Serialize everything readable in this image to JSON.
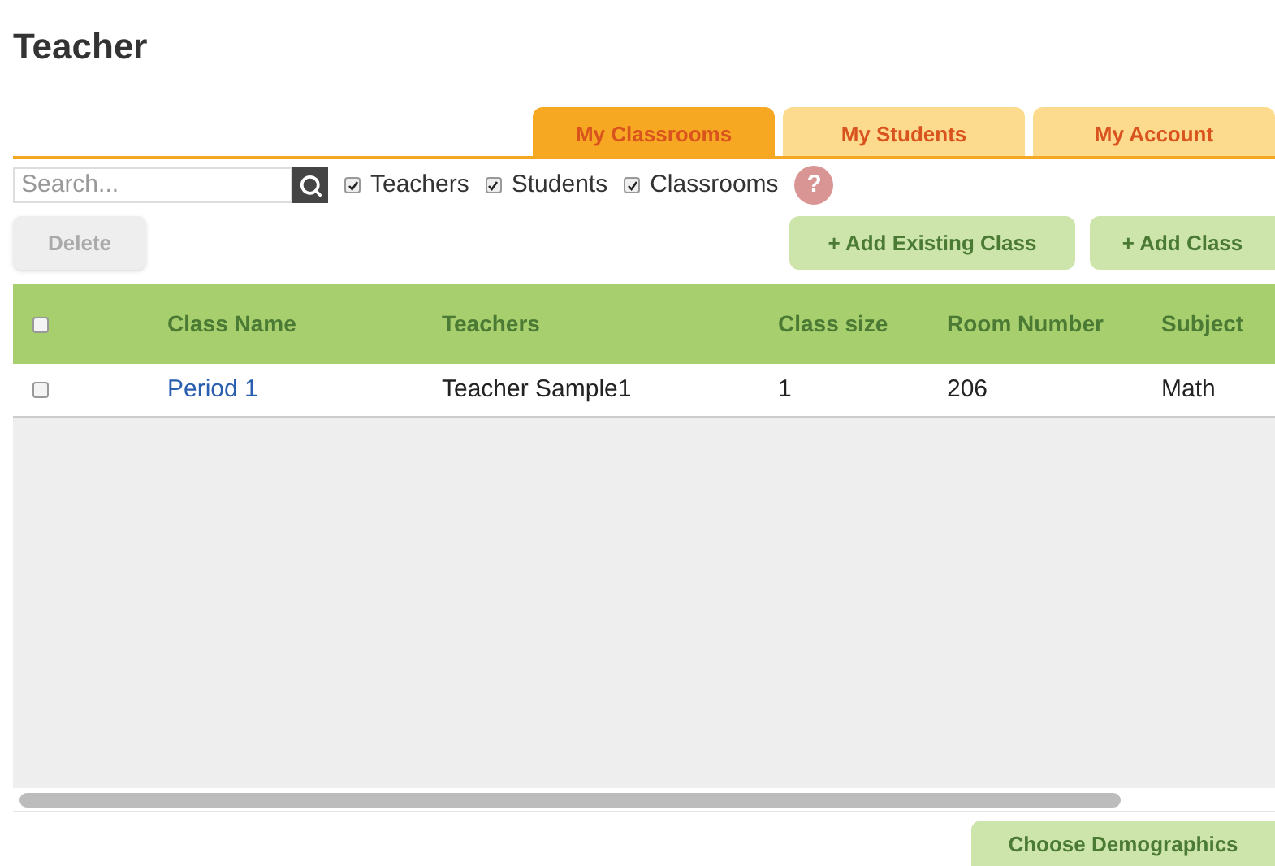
{
  "page_title": "Teacher",
  "tabs": [
    {
      "label": "My Classrooms",
      "selected": true
    },
    {
      "label": "My Students",
      "selected": false
    },
    {
      "label": "My Account",
      "selected": false
    }
  ],
  "search": {
    "placeholder": "Search..."
  },
  "filters": [
    {
      "label": "Teachers",
      "checked": true
    },
    {
      "label": "Students",
      "checked": true
    },
    {
      "label": "Classrooms",
      "checked": true
    }
  ],
  "help": "?",
  "buttons": {
    "delete": {
      "label": "Delete",
      "disabled": true
    },
    "add_existing": "+ Add Existing Class",
    "add": "+ Add Class",
    "demographics": "Choose Demographics"
  },
  "table": {
    "select_all_checked": false,
    "columns": [
      "Class Name",
      "Teachers",
      "Class size",
      "Room Number",
      "Subject"
    ],
    "rows": [
      {
        "checked": false,
        "cells": [
          "Period 1",
          "Teacher Sample1",
          "1",
          "206",
          "Math"
        ]
      }
    ]
  }
}
